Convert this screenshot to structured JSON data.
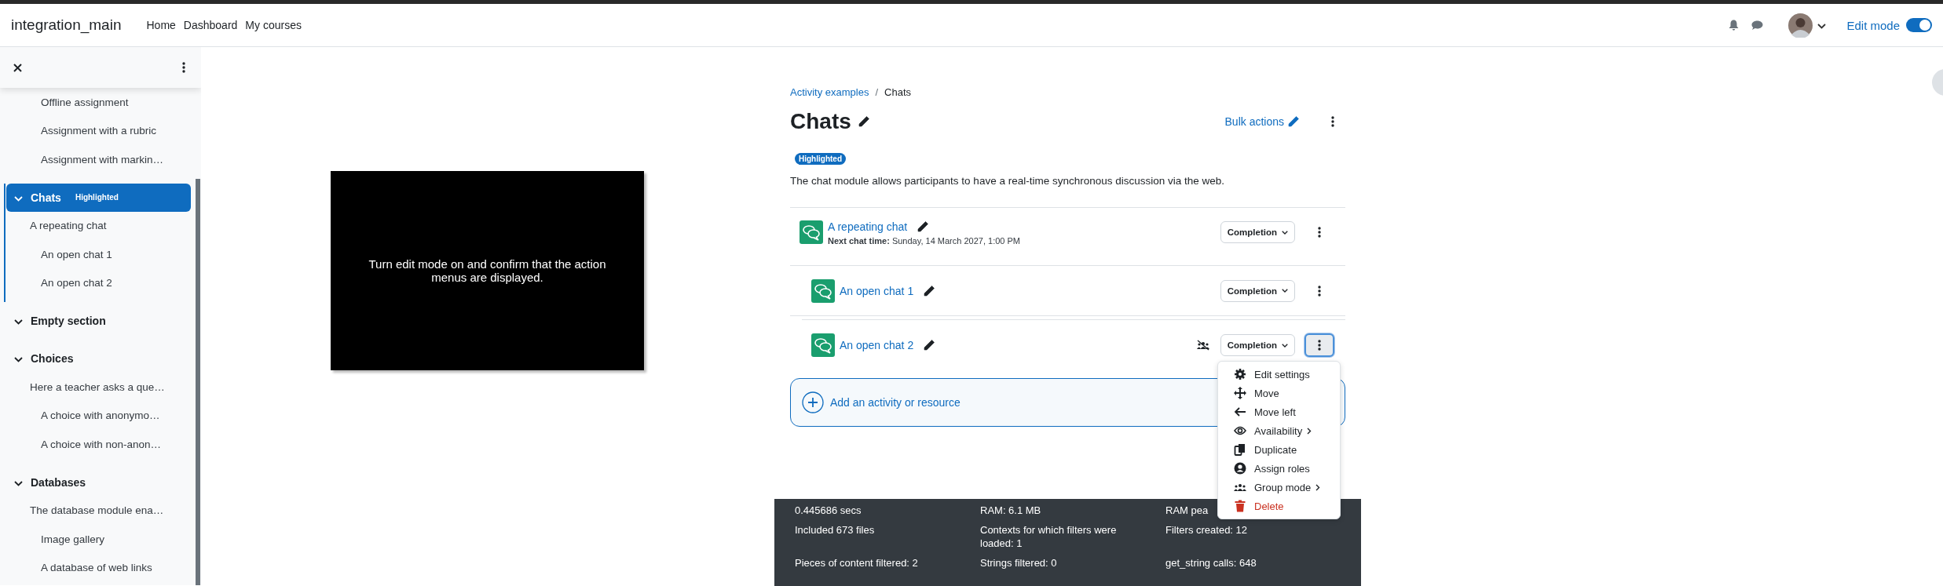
{
  "navbar": {
    "brand": "integration_main",
    "links": [
      "Home",
      "Dashboard",
      "My courses"
    ],
    "edit_mode": {
      "label": "Edit mode",
      "on": true
    }
  },
  "sidebar": {
    "sections": [
      {
        "items": [
          {
            "children": [
              {
                "title": "Offline assignment"
              },
              {
                "title": "Assignment with a rubric"
              },
              {
                "title": "Assignment with markin…"
              }
            ]
          }
        ]
      },
      {
        "title": "Chats",
        "badge": "Highlighted",
        "selected": true,
        "expanded": true,
        "items": [
          {
            "title": "A repeating chat",
            "children": [
              {
                "title": "An open chat 1"
              },
              {
                "title": "An open chat 2"
              }
            ]
          }
        ]
      },
      {
        "title": "Empty section",
        "selected": false,
        "expanded": true
      },
      {
        "title": "Choices",
        "selected": false,
        "expanded": true,
        "items": [
          {
            "title": "Here a teacher asks a que…",
            "children": [
              {
                "title": "A choice with anonymo…"
              },
              {
                "title": "A choice with non-anon…"
              }
            ]
          }
        ]
      },
      {
        "title": "Databases",
        "selected": false,
        "expanded": true,
        "items": [
          {
            "title": "The database module ena…",
            "children": [
              {
                "title": "Image gallery"
              },
              {
                "title": "A database of web links"
              }
            ]
          }
        ]
      }
    ]
  },
  "notice": {
    "text": "Turn edit mode on and confirm that the action menus are displayed."
  },
  "breadcrumb": {
    "items": [
      "Activity examples",
      "Chats"
    ],
    "separator": "/"
  },
  "title": "Chats",
  "bulk_actions": "Bulk actions",
  "badge": "Highlighted",
  "description": "The chat module allows participants to have a real-time synchronous discussion via the web.",
  "activities": [
    {
      "title": "A repeating chat",
      "detail": "**Next chat time:** Sunday, 14 March 2027, 1:00 PM",
      "completion": "Completion",
      "menu_open": false,
      "children": [
        {
          "title": "An open chat 1",
          "completion": "Completion",
          "menu_open": false
        },
        {
          "title": "An open chat 2",
          "completion": "Completion",
          "group_mode": true,
          "menu_open": true
        }
      ]
    }
  ],
  "add_activity": "Add an activity or resource",
  "action_menu": [
    {
      "kind": "settings",
      "label": "Edit settings"
    },
    {
      "kind": "move",
      "label": "Move"
    },
    {
      "kind": "move-left",
      "label": "Move left"
    },
    {
      "kind": "availability",
      "label": "Availability",
      "submenu": true
    },
    {
      "kind": "duplicate",
      "label": "Duplicate"
    },
    {
      "kind": "roles",
      "label": "Assign roles"
    },
    {
      "kind": "group",
      "label": "Group mode",
      "submenu": true
    },
    {
      "kind": "delete",
      "label": "Delete"
    }
  ],
  "footer": [
    [
      "0.445686 secs",
      "RAM: 6.1 MB",
      "RAM pea"
    ],
    [
      "Included 673 files",
      "Contexts for which filters were loaded: 1",
      "Filters created: 12"
    ],
    [
      "Pieces of content filtered: 2",
      "Strings filtered: 0",
      "get_string calls: 648"
    ]
  ]
}
